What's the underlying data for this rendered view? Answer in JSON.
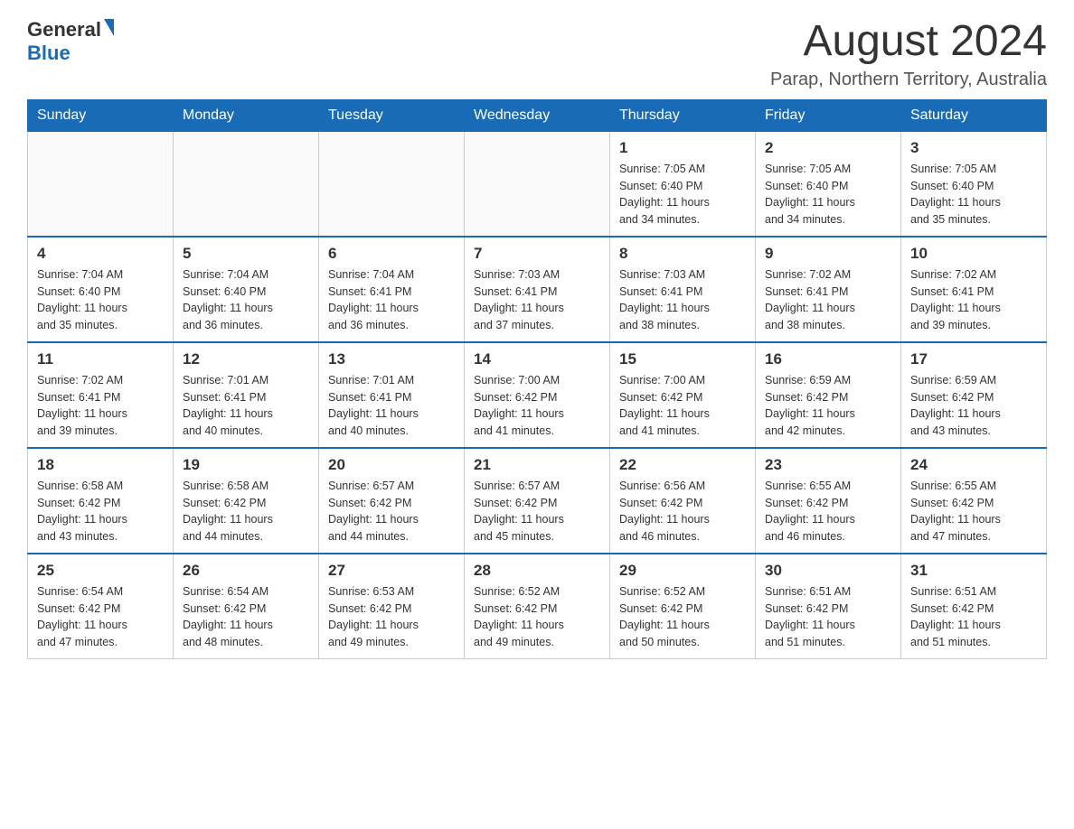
{
  "header": {
    "logo": {
      "general": "General",
      "blue": "Blue"
    },
    "title": "August 2024",
    "location": "Parap, Northern Territory, Australia"
  },
  "calendar": {
    "days_of_week": [
      "Sunday",
      "Monday",
      "Tuesday",
      "Wednesday",
      "Thursday",
      "Friday",
      "Saturday"
    ],
    "weeks": [
      [
        {
          "day": "",
          "info": ""
        },
        {
          "day": "",
          "info": ""
        },
        {
          "day": "",
          "info": ""
        },
        {
          "day": "",
          "info": ""
        },
        {
          "day": "1",
          "info": "Sunrise: 7:05 AM\nSunset: 6:40 PM\nDaylight: 11 hours\nand 34 minutes."
        },
        {
          "day": "2",
          "info": "Sunrise: 7:05 AM\nSunset: 6:40 PM\nDaylight: 11 hours\nand 34 minutes."
        },
        {
          "day": "3",
          "info": "Sunrise: 7:05 AM\nSunset: 6:40 PM\nDaylight: 11 hours\nand 35 minutes."
        }
      ],
      [
        {
          "day": "4",
          "info": "Sunrise: 7:04 AM\nSunset: 6:40 PM\nDaylight: 11 hours\nand 35 minutes."
        },
        {
          "day": "5",
          "info": "Sunrise: 7:04 AM\nSunset: 6:40 PM\nDaylight: 11 hours\nand 36 minutes."
        },
        {
          "day": "6",
          "info": "Sunrise: 7:04 AM\nSunset: 6:41 PM\nDaylight: 11 hours\nand 36 minutes."
        },
        {
          "day": "7",
          "info": "Sunrise: 7:03 AM\nSunset: 6:41 PM\nDaylight: 11 hours\nand 37 minutes."
        },
        {
          "day": "8",
          "info": "Sunrise: 7:03 AM\nSunset: 6:41 PM\nDaylight: 11 hours\nand 38 minutes."
        },
        {
          "day": "9",
          "info": "Sunrise: 7:02 AM\nSunset: 6:41 PM\nDaylight: 11 hours\nand 38 minutes."
        },
        {
          "day": "10",
          "info": "Sunrise: 7:02 AM\nSunset: 6:41 PM\nDaylight: 11 hours\nand 39 minutes."
        }
      ],
      [
        {
          "day": "11",
          "info": "Sunrise: 7:02 AM\nSunset: 6:41 PM\nDaylight: 11 hours\nand 39 minutes."
        },
        {
          "day": "12",
          "info": "Sunrise: 7:01 AM\nSunset: 6:41 PM\nDaylight: 11 hours\nand 40 minutes."
        },
        {
          "day": "13",
          "info": "Sunrise: 7:01 AM\nSunset: 6:41 PM\nDaylight: 11 hours\nand 40 minutes."
        },
        {
          "day": "14",
          "info": "Sunrise: 7:00 AM\nSunset: 6:42 PM\nDaylight: 11 hours\nand 41 minutes."
        },
        {
          "day": "15",
          "info": "Sunrise: 7:00 AM\nSunset: 6:42 PM\nDaylight: 11 hours\nand 41 minutes."
        },
        {
          "day": "16",
          "info": "Sunrise: 6:59 AM\nSunset: 6:42 PM\nDaylight: 11 hours\nand 42 minutes."
        },
        {
          "day": "17",
          "info": "Sunrise: 6:59 AM\nSunset: 6:42 PM\nDaylight: 11 hours\nand 43 minutes."
        }
      ],
      [
        {
          "day": "18",
          "info": "Sunrise: 6:58 AM\nSunset: 6:42 PM\nDaylight: 11 hours\nand 43 minutes."
        },
        {
          "day": "19",
          "info": "Sunrise: 6:58 AM\nSunset: 6:42 PM\nDaylight: 11 hours\nand 44 minutes."
        },
        {
          "day": "20",
          "info": "Sunrise: 6:57 AM\nSunset: 6:42 PM\nDaylight: 11 hours\nand 44 minutes."
        },
        {
          "day": "21",
          "info": "Sunrise: 6:57 AM\nSunset: 6:42 PM\nDaylight: 11 hours\nand 45 minutes."
        },
        {
          "day": "22",
          "info": "Sunrise: 6:56 AM\nSunset: 6:42 PM\nDaylight: 11 hours\nand 46 minutes."
        },
        {
          "day": "23",
          "info": "Sunrise: 6:55 AM\nSunset: 6:42 PM\nDaylight: 11 hours\nand 46 minutes."
        },
        {
          "day": "24",
          "info": "Sunrise: 6:55 AM\nSunset: 6:42 PM\nDaylight: 11 hours\nand 47 minutes."
        }
      ],
      [
        {
          "day": "25",
          "info": "Sunrise: 6:54 AM\nSunset: 6:42 PM\nDaylight: 11 hours\nand 47 minutes."
        },
        {
          "day": "26",
          "info": "Sunrise: 6:54 AM\nSunset: 6:42 PM\nDaylight: 11 hours\nand 48 minutes."
        },
        {
          "day": "27",
          "info": "Sunrise: 6:53 AM\nSunset: 6:42 PM\nDaylight: 11 hours\nand 49 minutes."
        },
        {
          "day": "28",
          "info": "Sunrise: 6:52 AM\nSunset: 6:42 PM\nDaylight: 11 hours\nand 49 minutes."
        },
        {
          "day": "29",
          "info": "Sunrise: 6:52 AM\nSunset: 6:42 PM\nDaylight: 11 hours\nand 50 minutes."
        },
        {
          "day": "30",
          "info": "Sunrise: 6:51 AM\nSunset: 6:42 PM\nDaylight: 11 hours\nand 51 minutes."
        },
        {
          "day": "31",
          "info": "Sunrise: 6:51 AM\nSunset: 6:42 PM\nDaylight: 11 hours\nand 51 minutes."
        }
      ]
    ]
  }
}
